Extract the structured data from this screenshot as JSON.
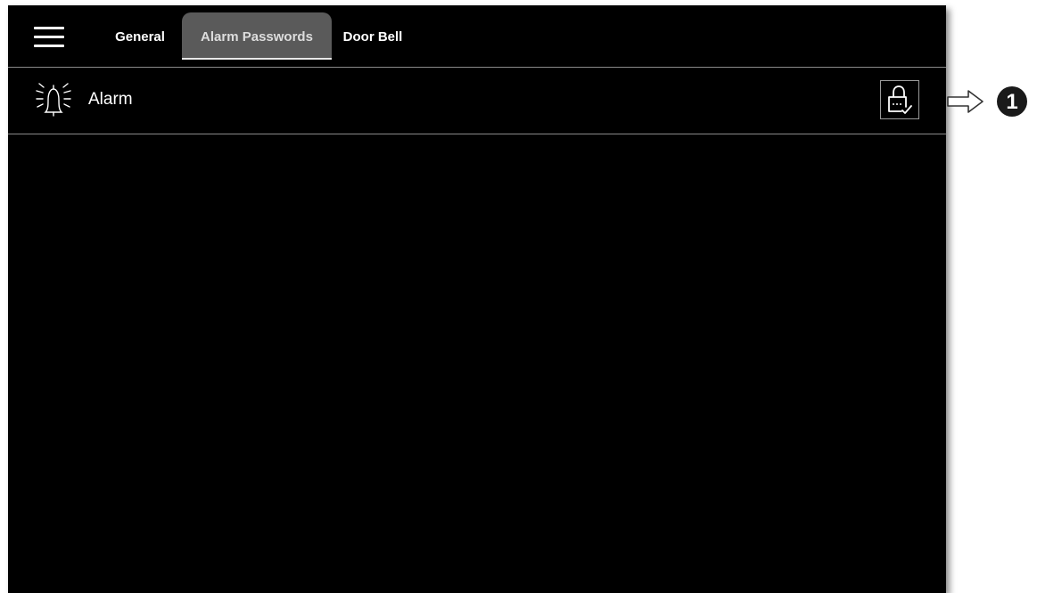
{
  "tabs": {
    "general": "General",
    "alarm_passwords": "Alarm Passwords",
    "door_bell": "Door Bell",
    "active": "alarm_passwords"
  },
  "alarm_row": {
    "label": "Alarm",
    "icon": "alarm-bell-icon",
    "action_icon": "lock-check-icon"
  },
  "callout": {
    "number": "1",
    "icon": "outline-arrow-right-icon"
  },
  "colors": {
    "background": "#000000",
    "active_tab": "#5a5a5a",
    "text": "#ffffff",
    "divider": "#8a8a8a"
  }
}
